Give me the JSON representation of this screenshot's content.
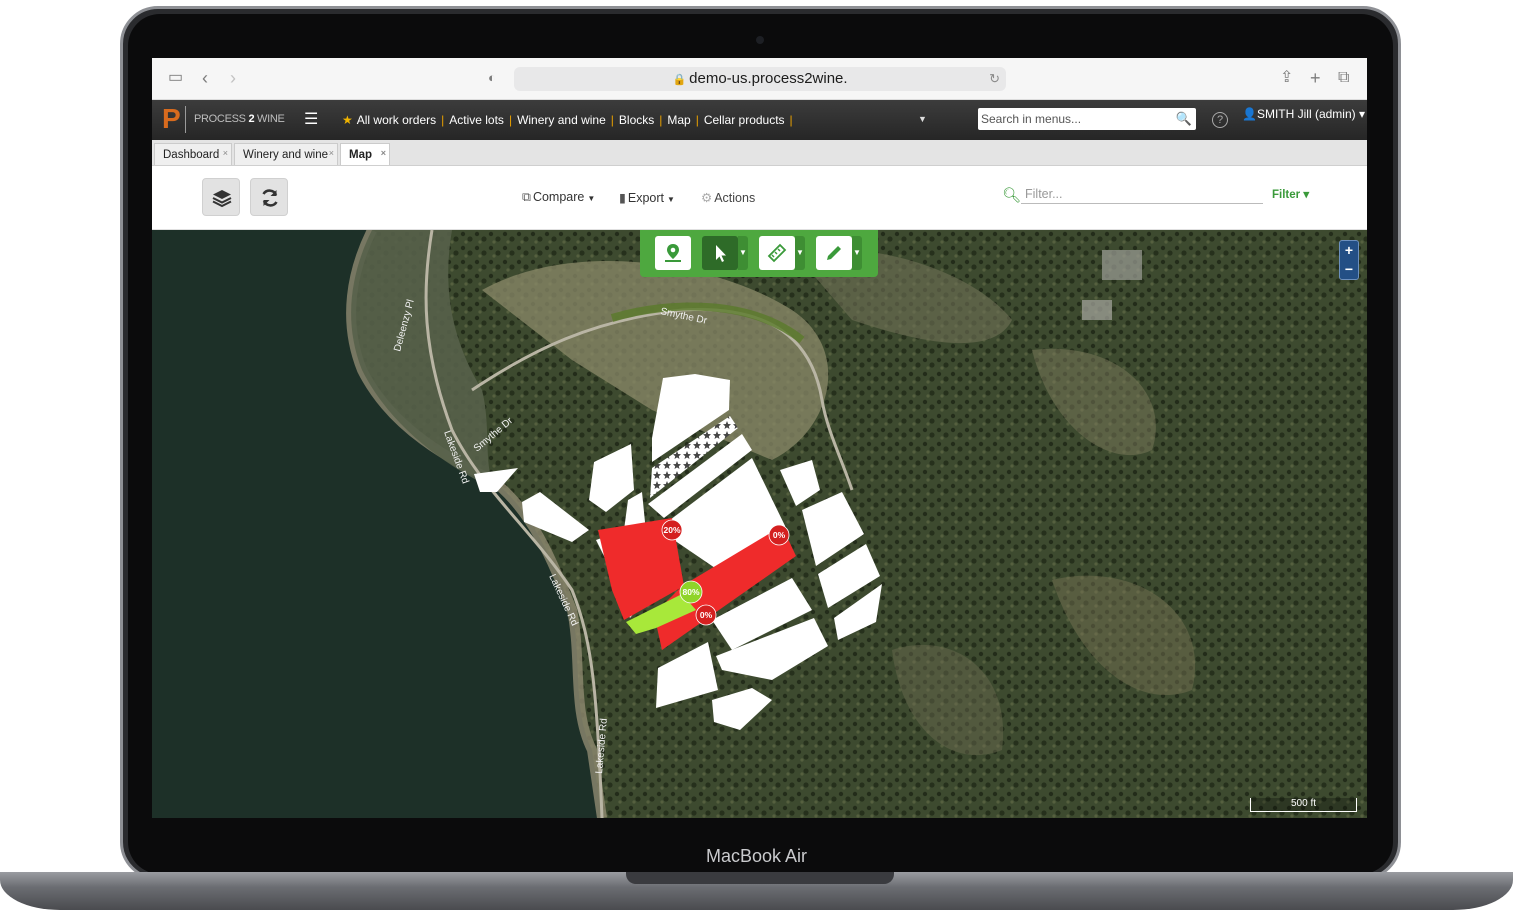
{
  "device": {
    "label": "MacBook Air"
  },
  "browser": {
    "url": "demo-us.process2wine."
  },
  "app": {
    "logo_text_prefix": "PROCESS ",
    "logo_text_mid": "2",
    "logo_text_suffix": " WINE",
    "quick_links": [
      "All work orders",
      "Active lots",
      "Winery and wine",
      "Blocks",
      "Map",
      "Cellar products"
    ],
    "search_placeholder": "Search in menus...",
    "user": "SMITH Jill (admin)"
  },
  "tabs": [
    {
      "label": "Dashboard",
      "active": false
    },
    {
      "label": "Winery and wine",
      "active": false
    },
    {
      "label": "Map",
      "active": true
    }
  ],
  "toolbar": {
    "compare_label": "Compare",
    "export_label": "Export",
    "actions_label": "Actions",
    "filter_placeholder": "Filter...",
    "filter_button": "Filter"
  },
  "map": {
    "zoom_in": "+",
    "zoom_out": "−",
    "scale_label": "500 ft",
    "road_labels": [
      "Smythe Dr",
      "Smythe Dr",
      "Lakeside Rd",
      "Lakeside Rd",
      "Lakeside Rd",
      "Deleenzy Pl"
    ],
    "block_badges": [
      {
        "label": "20%",
        "status": "red"
      },
      {
        "label": "0%",
        "status": "red"
      },
      {
        "label": "80%",
        "status": "green"
      },
      {
        "label": "0%",
        "status": "red"
      }
    ]
  },
  "colors": {
    "accent_green": "#4ea83f",
    "block_red": "#ef2b2b",
    "block_green": "#a8e83a",
    "header_dark": "#2c2c2c",
    "separator_orange": "#e8a000"
  }
}
